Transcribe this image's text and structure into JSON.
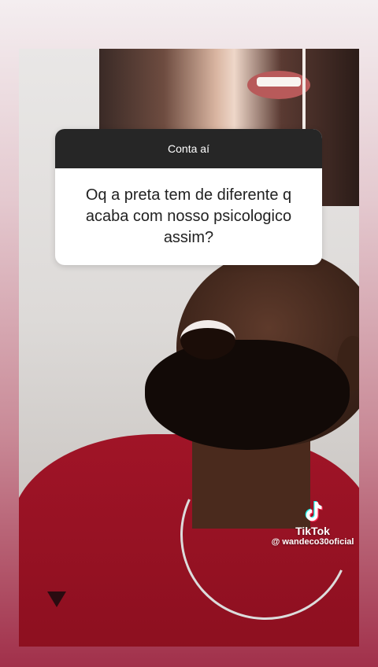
{
  "question_sticker": {
    "header": "Conta aí",
    "question": "Oq a preta tem de diferente q acaba com nosso psicologico assim?"
  },
  "watermark": {
    "brand": "TikTok",
    "handle": "@ wandeco30oficial",
    "icon": "tiktok-icon"
  },
  "colors": {
    "header_bg": "#262626",
    "card_bg": "#ffffff",
    "shirt": "#a01427",
    "background_bottom": "#a1304a"
  }
}
